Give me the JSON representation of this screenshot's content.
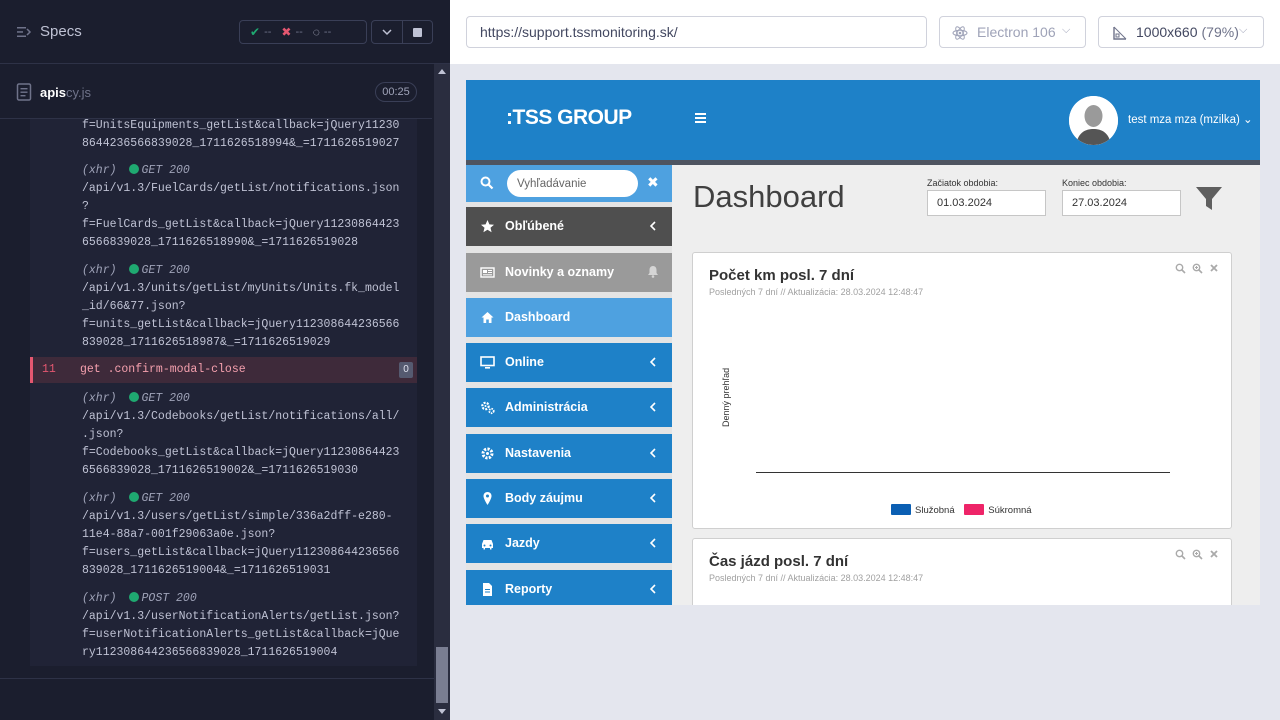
{
  "reporter": {
    "title": "Specs",
    "stats": {
      "passed": "--",
      "failed": "--",
      "pending": "--"
    },
    "spec_file": {
      "name": "apis",
      "ext": "cy.js",
      "duration": "00:25"
    },
    "log": [
      {
        "lines": [
          "f=UnitsEquipments_getList&callback=jQuery11230",
          "8644236566839028_1711626518994&_=1711626519027"
        ]
      },
      {
        "head": "(xhr)",
        "method": "GET 200",
        "lines": [
          "/api/v1.3/FuelCards/getList/notifications.json",
          "?",
          "f=FuelCards_getList&callback=jQuery11230864423",
          "6566839028_1711626518990&_=1711626519028"
        ]
      },
      {
        "head": "(xhr)",
        "method": "GET 200",
        "lines": [
          "/api/v1.3/units/getList/myUnits/Units.fk_model",
          "_id/66&77.json?",
          "f=units_getList&callback=jQuery112308644236566",
          "839028_1711626518987&_=1711626519029"
        ]
      },
      {
        "head": "(xhr)",
        "method": "GET 200",
        "lines": [
          "/api/v1.3/Codebooks/getList/notifications/all/",
          ".json?",
          "f=Codebooks_getList&callback=jQuery11230864423",
          "6566839028_1711626519002&_=1711626519030"
        ]
      },
      {
        "head": "(xhr)",
        "method": "GET 200",
        "lines": [
          "/api/v1.3/users/getList/simple/336a2dff-e280-",
          "11e4-88a7-001f29063a0e.json?",
          "f=users_getList&callback=jQuery112308644236566",
          "839028_1711626519004&_=1711626519031"
        ]
      },
      {
        "head": "(xhr)",
        "method": "POST 200",
        "lines": [
          "/api/v1.3/userNotificationAlerts/getList.json?",
          "f=userNotificationAlerts_getList&callback=jQue",
          "ry112308644236566839028_1711626519004"
        ]
      }
    ],
    "failed_command": {
      "number": "11",
      "name": "get  .confirm-modal-close",
      "count": "0"
    }
  },
  "toolbar": {
    "url": "https://support.tssmonitoring.sk/",
    "browser": "Electron 106",
    "viewport": "1000x660",
    "zoom": "(79%)"
  },
  "app": {
    "logo": ":TSS GROUP",
    "user": "test mza mza (mzilka)",
    "search_placeholder": "Vyhľadávanie",
    "sidebar": [
      {
        "label": "Obľúbené",
        "icon": "star-icon"
      },
      {
        "label": "Novinky a oznamy",
        "icon": "newspaper-icon"
      },
      {
        "label": "Dashboard",
        "icon": "home-icon"
      },
      {
        "label": "Online",
        "icon": "monitor-icon"
      },
      {
        "label": "Administrácia",
        "icon": "cogs-icon"
      },
      {
        "label": "Nastavenia",
        "icon": "gear-icon"
      },
      {
        "label": "Body záujmu",
        "icon": "map-pin-icon"
      },
      {
        "label": "Jazdy",
        "icon": "car-icon"
      },
      {
        "label": "Reporty",
        "icon": "file-icon"
      }
    ],
    "page_title": "Dashboard",
    "period": {
      "start_label": "Začiatok obdobia:",
      "start_value": "01.03.2024",
      "end_label": "Koniec obdobia:",
      "end_value": "27.03.2024"
    },
    "panels": [
      {
        "title": "Počet km posl. 7 dní",
        "subtitle": "Posledných 7 dní // Aktualizácia: 28.03.2024 12:48:47"
      },
      {
        "title": "Čas jázd posl. 7 dní",
        "subtitle": "Posledných 7 dní // Aktualizácia: 28.03.2024 12:48:47"
      }
    ],
    "chart": {
      "ylabel": "Denný prehľad",
      "legend": [
        {
          "name": "Služobná",
          "color": "#0b5fb3"
        },
        {
          "name": "Súkromná",
          "color": "#ee2468"
        }
      ]
    }
  },
  "colors": {
    "brand": "#1e81c8",
    "pass": "#1fa971",
    "fail": "#e45770"
  }
}
